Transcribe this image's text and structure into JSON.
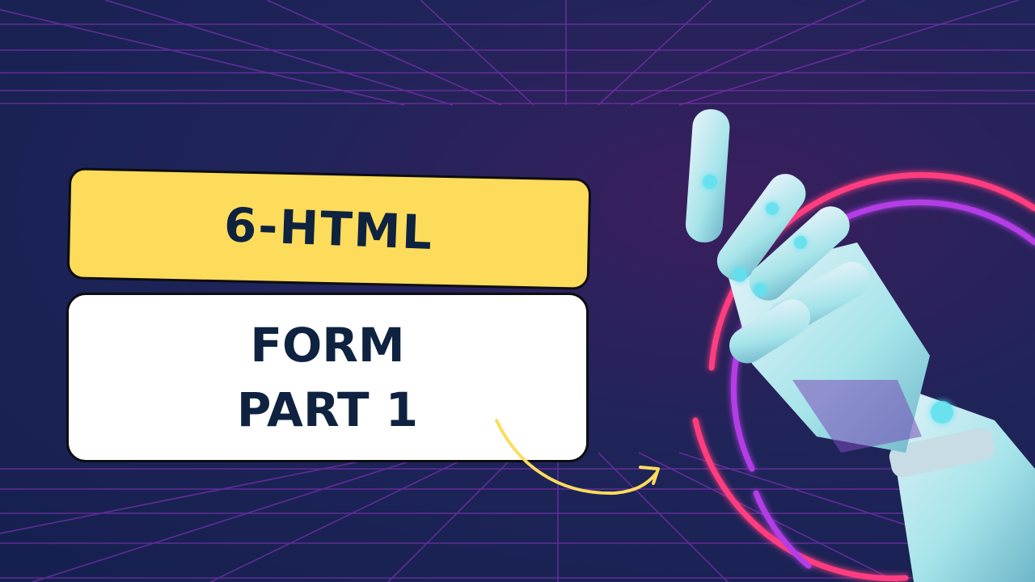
{
  "title": "6-HTML",
  "subtitle_lines": [
    "FORM",
    "PART 1"
  ],
  "colors": {
    "title_bg": "#fddc5c",
    "text": "#0f2340",
    "grid": "#a03ad6",
    "ring_pink": "#ff3d7f",
    "ring_purple": "#b43ee6",
    "arrow": "#fddc5c"
  },
  "icons": [
    "curved-arrow-icon",
    "robot-hand-illustration"
  ]
}
